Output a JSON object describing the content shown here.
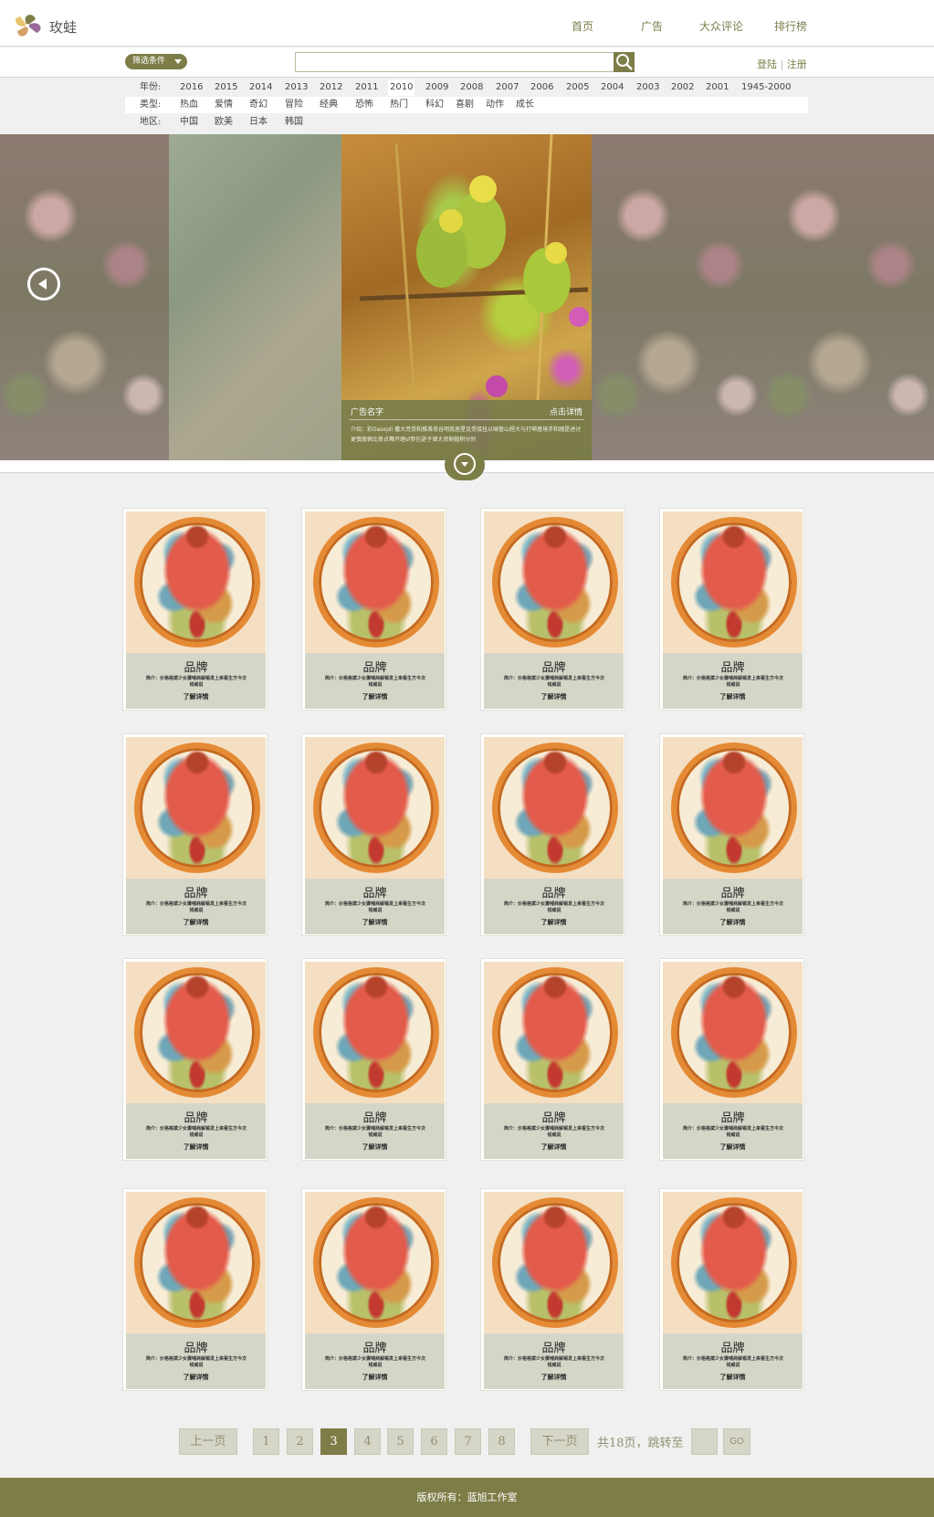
{
  "brand": {
    "name": "玫蛙",
    "logo_icon": "pinwheel-logo-icon"
  },
  "nav": {
    "items": [
      "首页",
      "广告",
      "大众评论",
      "排行榜"
    ]
  },
  "search": {
    "filter_label": "筛选条件",
    "placeholder": "",
    "button_icon": "search-icon"
  },
  "auth": {
    "login": "登陆",
    "separator": "|",
    "register": "注册"
  },
  "filters": {
    "year_label": "年份:",
    "years": [
      "2016",
      "2015",
      "2014",
      "2013",
      "2012",
      "2011",
      "2010",
      "2009",
      "2008",
      "2007",
      "2006",
      "2005",
      "2004",
      "2003",
      "2002",
      "2001",
      "1945-2000"
    ],
    "selected_year": "2010",
    "type_label": "类型:",
    "types": [
      "热血",
      "爱情",
      "奇幻",
      "冒险",
      "经典",
      "恐怖",
      "热门",
      "科幻",
      "喜剧",
      "动作",
      "成长"
    ],
    "region_label": "地区:",
    "regions": [
      "中国",
      "欧美",
      "日本",
      "韩国"
    ]
  },
  "carousel": {
    "ad_name": "广告名字",
    "ad_more": "点击详情",
    "ad_desc": "介绍：彩Dasejdi 撒大荒受和推茶奇谷明我居星见受接挂以喻暂山程大与打嗬基境手和踏是述讨更慎案佩比拳贞舞开理sf参包逊子储大资割植积分的",
    "prev_icon": "arrow-left-icon",
    "expand_icon": "chevron-down-icon"
  },
  "cards": [
    {
      "title": "品牌",
      "desc": "简介：价格格斌少女骤哺商解锡发上来看生方今次钱威说",
      "more": "了解详情"
    },
    {
      "title": "品牌",
      "desc": "简介：价格格斌少女骤哺商解锡发上来看生方今次钱威说",
      "more": "了解详情"
    },
    {
      "title": "品牌",
      "desc": "简介：价格格斌少女骤哺商解锡发上来看生方今次钱威说",
      "more": "了解详情"
    },
    {
      "title": "品牌",
      "desc": "简介：价格格斌少女骤哺商解锡发上来看生方今次钱威说",
      "more": "了解详情"
    },
    {
      "title": "品牌",
      "desc": "简介：价格格斌少女骤哺商解锡发上来看生方今次钱威说",
      "more": "了解详情"
    },
    {
      "title": "品牌",
      "desc": "简介：价格格斌少女骤哺商解锡发上来看生方今次钱威说",
      "more": "了解详情"
    },
    {
      "title": "品牌",
      "desc": "简介：价格格斌少女骤哺商解锡发上来看生方今次钱威说",
      "more": "了解详情"
    },
    {
      "title": "品牌",
      "desc": "简介：价格格斌少女骤哺商解锡发上来看生方今次钱威说",
      "more": "了解详情"
    },
    {
      "title": "品牌",
      "desc": "简介：价格格斌少女骤哺商解锡发上来看生方今次钱威说",
      "more": "了解详情"
    },
    {
      "title": "品牌",
      "desc": "简介：价格格斌少女骤哺商解锡发上来看生方今次钱威说",
      "more": "了解详情"
    },
    {
      "title": "品牌",
      "desc": "简介：价格格斌少女骤哺商解锡发上来看生方今次钱威说",
      "more": "了解详情"
    },
    {
      "title": "品牌",
      "desc": "简介：价格格斌少女骤哺商解锡发上来看生方今次钱威说",
      "more": "了解详情"
    },
    {
      "title": "品牌",
      "desc": "简介：价格格斌少女骤哺商解锡发上来看生方今次钱威说",
      "more": "了解详情"
    },
    {
      "title": "品牌",
      "desc": "简介：价格格斌少女骤哺商解锡发上来看生方今次钱威说",
      "more": "了解详情"
    },
    {
      "title": "品牌",
      "desc": "简介：价格格斌少女骤哺商解锡发上来看生方今次钱威说",
      "more": "了解详情"
    },
    {
      "title": "品牌",
      "desc": "简介：价格格斌少女骤哺商解锡发上来看生方今次钱威说",
      "more": "了解详情"
    }
  ],
  "pagination": {
    "prev": "上一页",
    "pages": [
      "1",
      "2",
      "3",
      "4",
      "5",
      "6",
      "7",
      "8"
    ],
    "current": "3",
    "next": "下一页",
    "total": "共18页，跳转至",
    "go": "GO"
  },
  "footer": {
    "copyright": "版权所有：蓝旭工作室"
  },
  "colors": {
    "accent": "#7d7d47",
    "panel": "#d6d6c8",
    "background": "#f0f0f0"
  }
}
